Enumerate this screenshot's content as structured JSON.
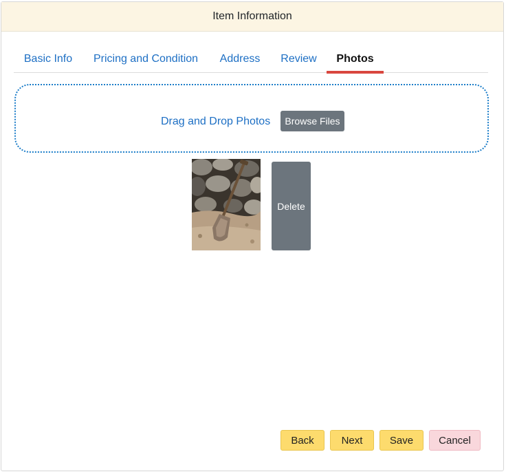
{
  "header": {
    "title": "Item Information"
  },
  "tabs": [
    {
      "label": "Basic Info"
    },
    {
      "label": "Pricing and Condition"
    },
    {
      "label": "Address"
    },
    {
      "label": "Review"
    },
    {
      "label": "Photos",
      "active": true
    }
  ],
  "dropzone": {
    "text": "Drag and Drop Photos",
    "browse_label": "Browse Files"
  },
  "photos": [
    {
      "subject": "shovel leaning on rocks",
      "delete_label": "Delete"
    }
  ],
  "footer": {
    "back_label": "Back",
    "next_label": "Next",
    "save_label": "Save",
    "cancel_label": "Cancel"
  },
  "colors": {
    "header_bg": "#fcf5e3",
    "tab_link": "#1d6fc4",
    "tab_active_underline": "#d9473f",
    "dropzone_border": "#1a7cc8",
    "secondary_button": "#6c757d",
    "warning_button": "#fddb6d",
    "cancel_button": "#f9d7dc"
  }
}
